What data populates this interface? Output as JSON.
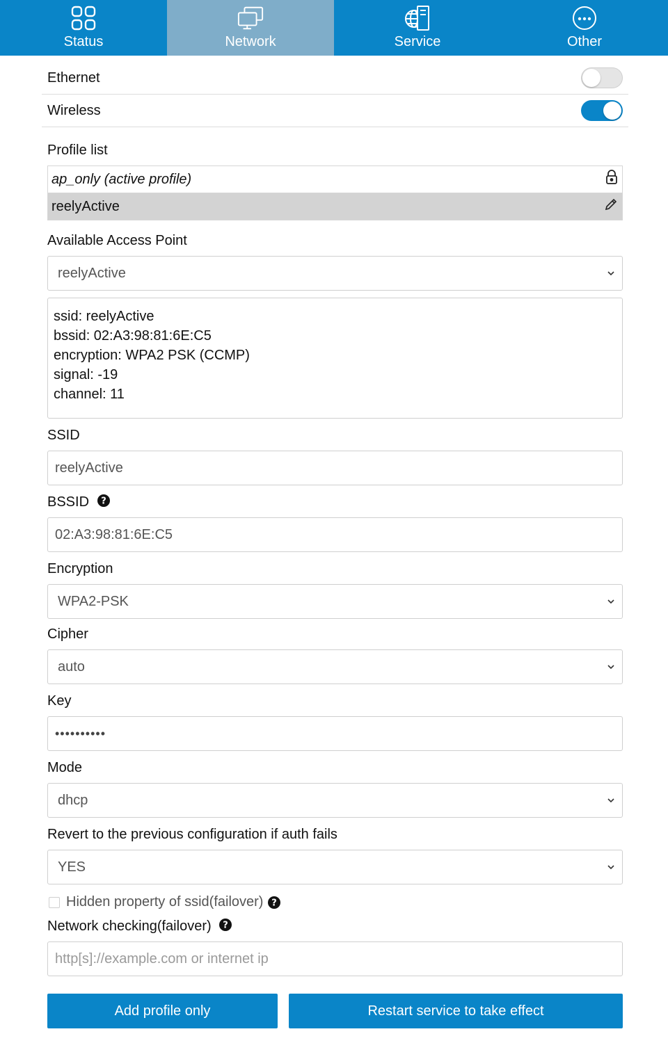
{
  "nav": {
    "tabs": [
      {
        "label": "Status",
        "icon": "grid-icon"
      },
      {
        "label": "Network",
        "icon": "monitors-icon"
      },
      {
        "label": "Service",
        "icon": "globe-server-icon"
      },
      {
        "label": "Other",
        "icon": "ellipsis-circle-icon"
      }
    ],
    "active": "Network"
  },
  "interfaces": {
    "ethernet": {
      "label": "Ethernet",
      "enabled": false
    },
    "wireless": {
      "label": "Wireless",
      "enabled": true
    }
  },
  "profiles": {
    "label": "Profile list",
    "items": [
      {
        "name": "ap_only (active profile)",
        "icon": "lock-icon"
      },
      {
        "name": "reelyActive",
        "icon": "pencil-icon",
        "selected": true
      }
    ]
  },
  "access_point": {
    "label": "Available Access Point",
    "selected": "reelyActive",
    "info": [
      "ssid: reelyActive",
      "bssid: 02:A3:98:81:6E:C5",
      "encryption: WPA2 PSK (CCMP)",
      "signal: -19",
      "channel: 11"
    ]
  },
  "form": {
    "ssid": {
      "label": "SSID",
      "value": "reelyActive"
    },
    "bssid": {
      "label": "BSSID",
      "value": "02:A3:98:81:6E:C5"
    },
    "encryption": {
      "label": "Encryption",
      "value": "WPA2-PSK"
    },
    "cipher": {
      "label": "Cipher",
      "value": "auto"
    },
    "key": {
      "label": "Key",
      "value": "••••••••••"
    },
    "mode": {
      "label": "Mode",
      "value": "dhcp"
    },
    "revert": {
      "label": "Revert to the previous configuration if auth fails",
      "value": "YES"
    },
    "hidden": {
      "label": "Hidden property of ssid(failover)",
      "checked": false
    },
    "netcheck": {
      "label": "Network checking(failover)",
      "placeholder": "http[s]://example.com or internet ip"
    }
  },
  "buttons": {
    "add": "Add profile only",
    "restart": "Restart service to take effect"
  },
  "colors": {
    "accent": "#0a85c8",
    "active_tab": "#7fadc9"
  }
}
